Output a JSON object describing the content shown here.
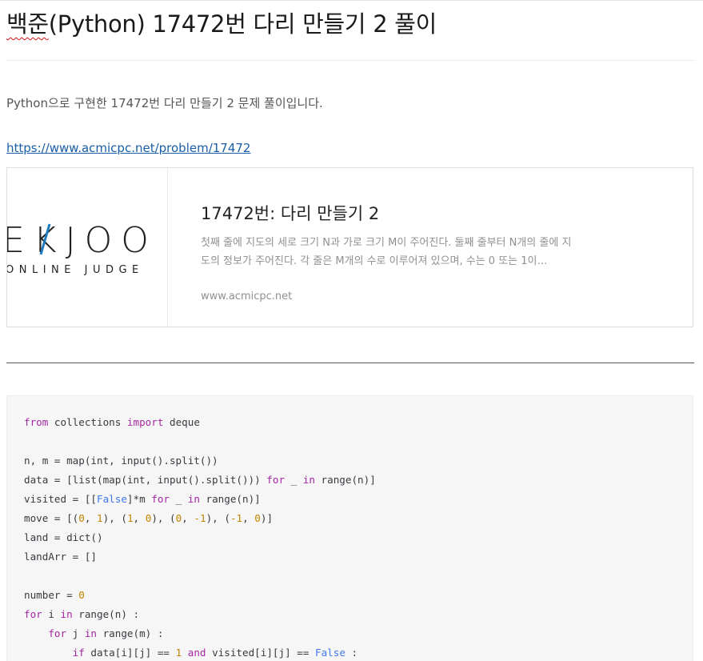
{
  "post": {
    "title_spell": "백준",
    "title_rest": "(Python) 17472번 다리 만들기 2 풀이",
    "intro": "Python으로 구현한 17472번 다리 만들기 2 문제 풀이입니다.",
    "link_text": "https://www.acmicpc.net/problem/17472"
  },
  "card": {
    "logo_main": "EKJOO",
    "logo_sub": "ONLINE JUDGE",
    "title": "17472번: 다리 만들기 2",
    "description": "첫째 줄에 지도의 세로 크기 N과 가로 크기 M이 주어진다. 둘째 줄부터 N개의 줄에 지도의 정보가 주어진다. 각 줄은 M개의 수로 이루어져 있으며, 수는 0 또는 1이…",
    "domain": "www.acmicpc.net"
  },
  "code": {
    "l1_kw_from": "from",
    "l1_mod": " collections ",
    "l1_kw_import": "import",
    "l1_name": " deque",
    "l3": "n, m = map(int, input().split())",
    "l4_a": "data = [list(map(int, input().split())) ",
    "l4_kw_for": "for",
    "l4_b": " _ ",
    "l4_kw_in": "in",
    "l4_c": " range(n)]",
    "l5_a": "visited = [[",
    "l5_false": "False",
    "l5_b": "]*m ",
    "l5_kw_for": "for",
    "l5_c": " _ ",
    "l5_kw_in": "in",
    "l5_d": " range(n)]",
    "l6_a": "move = [(",
    "l6_n1": "0",
    "l6_b": ", ",
    "l6_n2": "1",
    "l6_c": "), (",
    "l6_n3": "1",
    "l6_d": ", ",
    "l6_n4": "0",
    "l6_e": "), (",
    "l6_n5": "0",
    "l6_f": ", ",
    "l6_n6": "-1",
    "l6_g": "), (",
    "l6_n7": "-1",
    "l6_h": ", ",
    "l6_n8": "0",
    "l6_i": ")]",
    "l7": "land = dict()",
    "l8": "landArr = []",
    "l10_a": "number = ",
    "l10_n": "0",
    "l11_kw_for": "for",
    "l11_a": " i ",
    "l11_kw_in": "in",
    "l11_b": " range(n) :",
    "l12_indent": "    ",
    "l12_kw_for": "for",
    "l12_a": " j ",
    "l12_kw_in": "in",
    "l12_b": " range(m) :",
    "l13_indent": "        ",
    "l13_kw_if": "if",
    "l13_a": " data[i][j] == ",
    "l13_n": "1",
    "l13_sp": " ",
    "l13_kw_and": "and",
    "l13_b": " visited[i][j] == ",
    "l13_false": "False",
    "l13_c": " :"
  }
}
